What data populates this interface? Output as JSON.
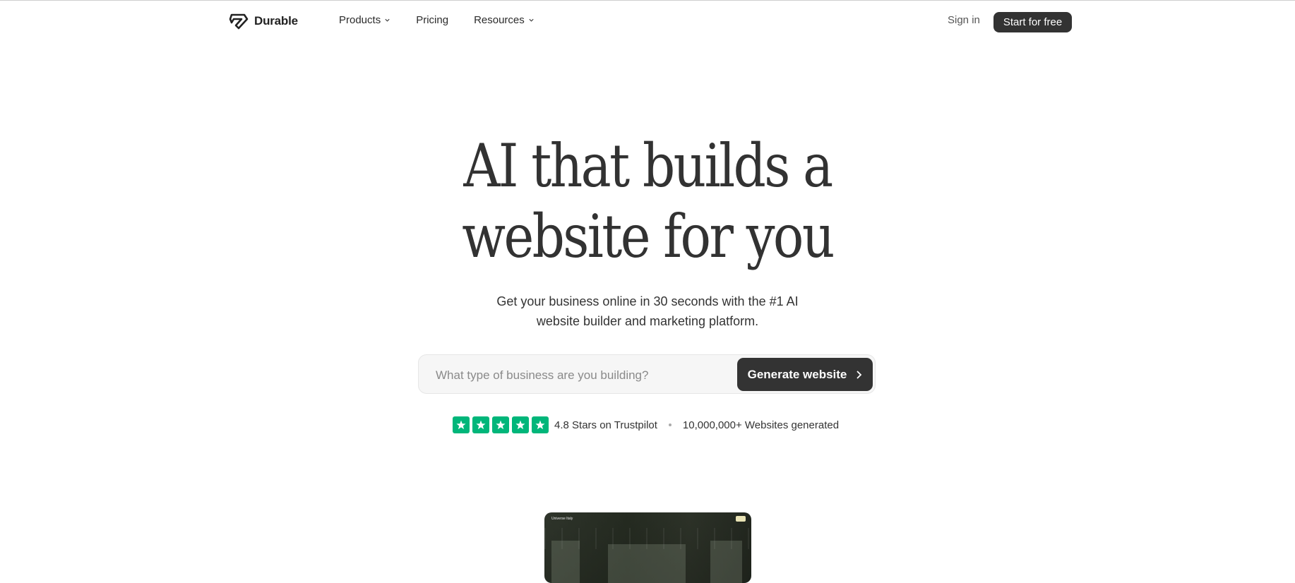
{
  "nav": {
    "brand": "Durable",
    "menu": [
      {
        "label": "Products",
        "has_dropdown": true
      },
      {
        "label": "Pricing",
        "has_dropdown": false
      },
      {
        "label": "Resources",
        "has_dropdown": true
      }
    ],
    "sign_in": "Sign in",
    "cta": "Start for free"
  },
  "hero": {
    "title_line1": "AI that builds a",
    "title_line2": "website for you",
    "subtitle_line1": "Get your business online in 30 seconds with the #1 AI",
    "subtitle_line2": "website builder and marketing platform."
  },
  "prompt": {
    "placeholder": "What type of business are you building?",
    "value": "",
    "button_label": "Generate website"
  },
  "trust": {
    "stars": 5,
    "rating_text": "4.8 Stars on Trustpilot",
    "count_text": "10,000,000+ Websites generated"
  },
  "preview": {
    "brand": "Universe Italy"
  },
  "colors": {
    "primary_dark": "#333333",
    "trustpilot_green": "#00b67a",
    "background": "#ffffff"
  },
  "icons": [
    "durable-logo-icon",
    "chevron-down-icon",
    "chevron-right-icon",
    "star-icon"
  ]
}
